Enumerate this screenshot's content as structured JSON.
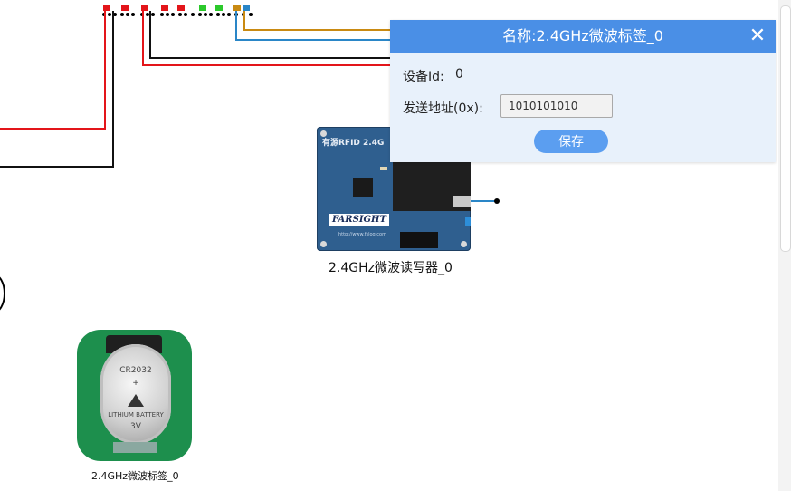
{
  "canvas": {
    "reader": {
      "label": "2.4GHz微波读写器_0",
      "silk_text": "有源RFID 2.4G",
      "brand_text": "FARSIGHT",
      "url_text": "http://www.fslog.com"
    },
    "tag": {
      "label": "2.4GHz微波标签_0",
      "battery_text_top": "CR2032",
      "battery_text_mid": "LITHIUM BATTERY",
      "battery_text_volt": "3V",
      "battery_sign": "+"
    },
    "wire_colors": {
      "red": "#e3151a",
      "black": "#111111",
      "blue": "#2a86c7",
      "orange": "#c98a12"
    }
  },
  "dialog": {
    "title": "名称:2.4GHz微波标签_0",
    "close_icon": "close-icon",
    "device_id_label": "设备Id:",
    "device_id_value": "0",
    "send_address_label": "发送地址(0x):",
    "send_address_value": "1010101010",
    "save_label": "保存",
    "colors": {
      "titlebar": "#4a8fe6",
      "body": "#e8f1fb",
      "button": "#5b9ef0"
    }
  },
  "scrollbar": {
    "orientation": "vertical"
  }
}
